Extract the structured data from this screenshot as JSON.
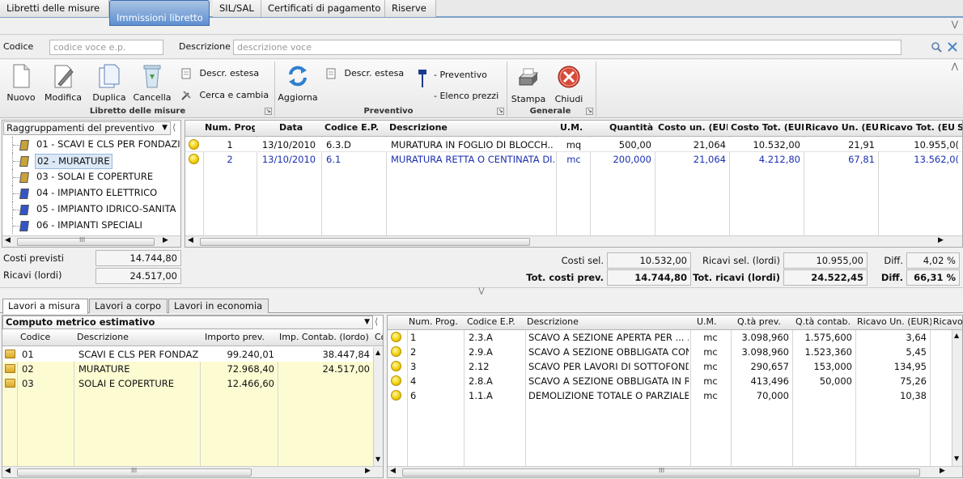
{
  "tabs": [
    "Libretti delle misure",
    "Immissioni libretto",
    "SIL/SAL",
    "Certificati di pagamento",
    "Riserve"
  ],
  "search": {
    "code_label": "Codice",
    "code_placeholder": "codice voce  e.p.",
    "desc_label": "Descrizione",
    "desc_placeholder": "descrizione voce"
  },
  "ribbon": {
    "libretto": {
      "nuovo": "Nuovo",
      "modifica": "Modifica",
      "duplica": "Duplica",
      "cancella": "Cancella",
      "descr_estesa": "Descr. estesa",
      "cerca_cambia": "Cerca e cambia",
      "group": "Libretto delle misure"
    },
    "preventivo": {
      "aggiorna": "Aggiorna",
      "descr_estesa": "Descr. estesa",
      "preventivo": "- Preventivo",
      "elenco_prezzi": "- Elenco prezzi",
      "group": "Preventivo"
    },
    "generale": {
      "stampa": "Stampa",
      "chiudi": "Chiudi",
      "group": "Generale"
    }
  },
  "groups": {
    "combo": "Raggruppamenti del preventivo",
    "items": [
      "01 - SCAVI E CLS PER FONDAZIC",
      "02 - MURATURE",
      "03 - SOLAI E COPERTURE",
      "04 - IMPIANTO ELETTRICO",
      "05 - IMPIANTO IDRICO-SANITA",
      "06 - IMPIANTI SPECIALI"
    ]
  },
  "entries": {
    "headers": [
      "Num. Prog.",
      "Data",
      "Codice E.P.",
      "Descrizione",
      "U.M.",
      "Quantità",
      "Costo un. (EUR)",
      "Costo Tot. (EUR)",
      "Ricavo Un. (EUR)",
      "Ricavo Tot. (EUR)",
      "S"
    ],
    "rows": [
      [
        "1",
        "13/10/2010",
        "6.3.D",
        "MURATURA IN FOGLIO DI BLOCCH...",
        "mq",
        "500,00",
        "21,064",
        "10.532,00",
        "21,91",
        "10.955,0("
      ],
      [
        "2",
        "13/10/2010",
        "6.1",
        "MURATURA RETTA O CENTINATA DI...",
        "mc",
        "200,000",
        "21,064",
        "4.212,80",
        "67,81",
        "13.562,0("
      ]
    ]
  },
  "totals": {
    "costi_previsti_label": "Costi previsti",
    "costi_previsti": "14.744,80",
    "ricavi_label": "Ricavi (lordi)",
    "ricavi": "24.517,00",
    "costi_sel_label": "Costi sel.",
    "costi_sel": "10.532,00",
    "ricavi_sel_label": "Ricavi sel. (lordi)",
    "ricavi_sel": "10.955,00",
    "diff_label": "Diff.",
    "diff": "4,02 %",
    "tot_costi_label": "Tot. costi prev.",
    "tot_costi": "14.744,80",
    "tot_ricavi_label": "Tot. ricavi (lordi)",
    "tot_ricavi": "24.522,45",
    "diff2_label": "Diff.",
    "diff2": "66,31 %"
  },
  "bottom_tabs": [
    "Lavori a misura",
    "Lavori a corpo",
    "Lavori in economia"
  ],
  "computo": {
    "combo": "Computo metrico estimativo",
    "headers": [
      "Codice",
      "Descrizione",
      "Importo prev.",
      "Imp. Contab. (lordo)",
      "Co"
    ],
    "rows": [
      [
        "01",
        "SCAVI E CLS PER FONDAZI...",
        "99.240,01",
        "38.447,84"
      ],
      [
        "02",
        "MURATURE",
        "72.968,40",
        "24.517,00"
      ],
      [
        "03",
        "SOLAI E COPERTURE",
        "12.466,60",
        ""
      ]
    ]
  },
  "voci": {
    "headers": [
      "Num. Prog.",
      "Codice E.P.",
      "Descrizione",
      "U.M.",
      "Q.tà prev.",
      "Q.tà contab.",
      "Ricavo Un. (EUR)",
      "Ricavo"
    ],
    "rows": [
      [
        "1",
        "2.3.A",
        "SCAVO A SEZIONE  APERTA  PER  ... ...",
        "mc",
        "3.098,960",
        "1.575,600",
        "3,64"
      ],
      [
        "2",
        "2.9.A",
        "SCAVO A SEZIONE OBBLIGATA CON...",
        "mc",
        "3.098,960",
        "1.523,360",
        "5,45"
      ],
      [
        "3",
        "2.12",
        "SCAVO PER LAVORI DI SOTTOFOND...",
        "mc",
        "290,657",
        "153,000",
        "134,95"
      ],
      [
        "4",
        "2.8.A",
        "SCAVO A SEZIONE OBBLIGATA IN R...",
        "mc",
        "413,496",
        "50,000",
        "75,26"
      ],
      [
        "6",
        "1.1.A",
        "DEMOLIZIONE TOTALE O PARZIALE ...",
        "mc",
        "70,000",
        "",
        "10,38"
      ]
    ]
  }
}
